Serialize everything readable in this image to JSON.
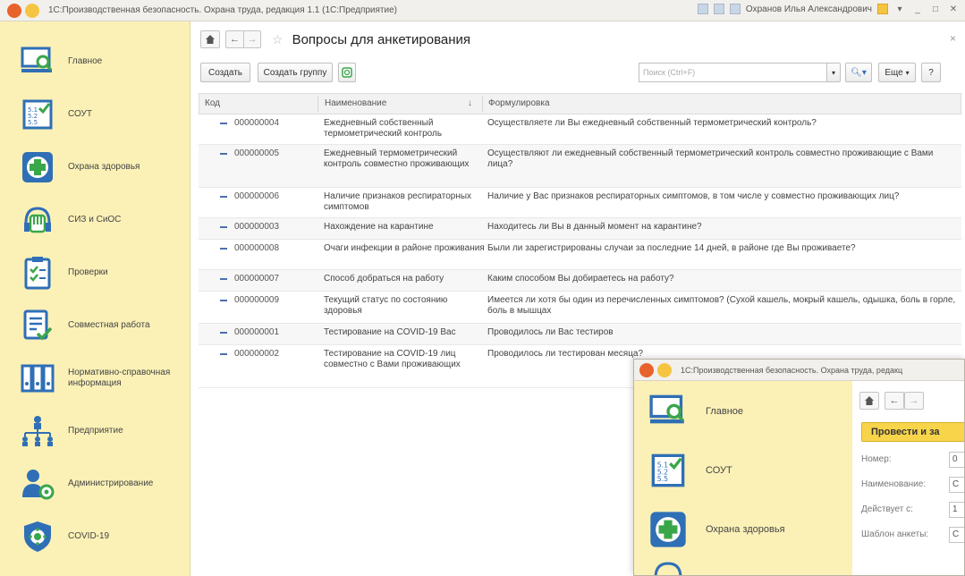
{
  "window": {
    "title": "1С:Производственная безопасность. Охрана труда, редакция 1.1 (1С:Предприятие)",
    "user": "Охранов Илья Александрович"
  },
  "sidebar": {
    "items": [
      {
        "label": "Главное",
        "icon": "monitor-search-icon"
      },
      {
        "label": "СОУТ",
        "icon": "checklist-icon"
      },
      {
        "label": "Охрана здоровья",
        "icon": "medical-cross-icon"
      },
      {
        "label": "СИЗ и СиОС",
        "icon": "glove-icon"
      },
      {
        "label": "Проверки",
        "icon": "clipboard-check-icon"
      },
      {
        "label": "Совместная работа",
        "icon": "document-check-icon"
      },
      {
        "label": "Нормативно-справочная информация",
        "icon": "binders-icon"
      },
      {
        "label": "Предприятие",
        "icon": "org-structure-icon"
      },
      {
        "label": "Администрирование",
        "icon": "admin-gear-icon"
      },
      {
        "label": "COVID-19",
        "icon": "shield-virus-icon"
      }
    ]
  },
  "page": {
    "title": "Вопросы для анкетирования",
    "create_label": "Создать",
    "create_group_label": "Создать группу",
    "search_placeholder": "Поиск (Ctrl+F)",
    "more_label": "Еще",
    "help_label": "?"
  },
  "table": {
    "columns": [
      "Код",
      "Наименование",
      "Формулировка"
    ],
    "rows": [
      {
        "code": "000000004",
        "name": "Ежедневный собственный термометрический контроль",
        "text": "Осуществляете ли Вы ежедневный собственный термометрический контроль?"
      },
      {
        "code": "000000005",
        "name": "Ежедневный термометрический контроль совместно проживающих",
        "text": "Осуществляют ли ежедневный собственный термометрический контроль совместно проживающие с Вами лица?"
      },
      {
        "code": "000000006",
        "name": "Наличие признаков респираторных симптомов",
        "text": "Наличие у Вас признаков респираторных симптомов, в том числе у совместно проживающих лиц?"
      },
      {
        "code": "000000003",
        "name": "Нахождение на карантине",
        "text": "Находитесь ли Вы в данный момент на карантине?"
      },
      {
        "code": "000000008",
        "name": "Очаги инфекции в районе проживания",
        "text": "Были ли зарегистрированы случаи за последние 14 дней, в районе где Вы проживаете?"
      },
      {
        "code": "000000007",
        "name": "Способ добраться на работу",
        "text": "Каким способом Вы добираетесь на работу?"
      },
      {
        "code": "000000009",
        "name": "Текущий статус по состоянию здоровья",
        "text": "Имеется ли хотя бы один из перечисленных симптомов? (Сухой кашель, мокрый кашель, одышка, боль в горле, боль в мышцах"
      },
      {
        "code": "000000001",
        "name": "Тестирование на COVID-19 Вас",
        "text": "Проводилось ли Вас тестиров"
      },
      {
        "code": "000000002",
        "name": "Тестирование на COVID-19 лиц совместно с Вами проживающих",
        "text": "Проводилось ли тестирован месяца?"
      }
    ]
  },
  "overlay": {
    "title": "1С:Производственная безопасность. Охрана труда, редакц",
    "sidebar": [
      {
        "label": "Главное",
        "icon": "monitor-search-icon"
      },
      {
        "label": "СОУТ",
        "icon": "checklist-icon"
      },
      {
        "label": "Охрана здоровья",
        "icon": "medical-cross-icon"
      }
    ],
    "post_label": "Провести и за",
    "fields": [
      {
        "label": "Номер:",
        "value": "0"
      },
      {
        "label": "Наименование:",
        "value": "С"
      },
      {
        "label": "Действует с:",
        "value": "1"
      },
      {
        "label": "Шаблон анкеты:",
        "value": "С"
      }
    ]
  },
  "colors": {
    "sidebar_bg": "#fbf1b7",
    "accent_blue": "#2f6fb6",
    "accent_green": "#3aa64a",
    "post_button": "#f8d44a"
  }
}
